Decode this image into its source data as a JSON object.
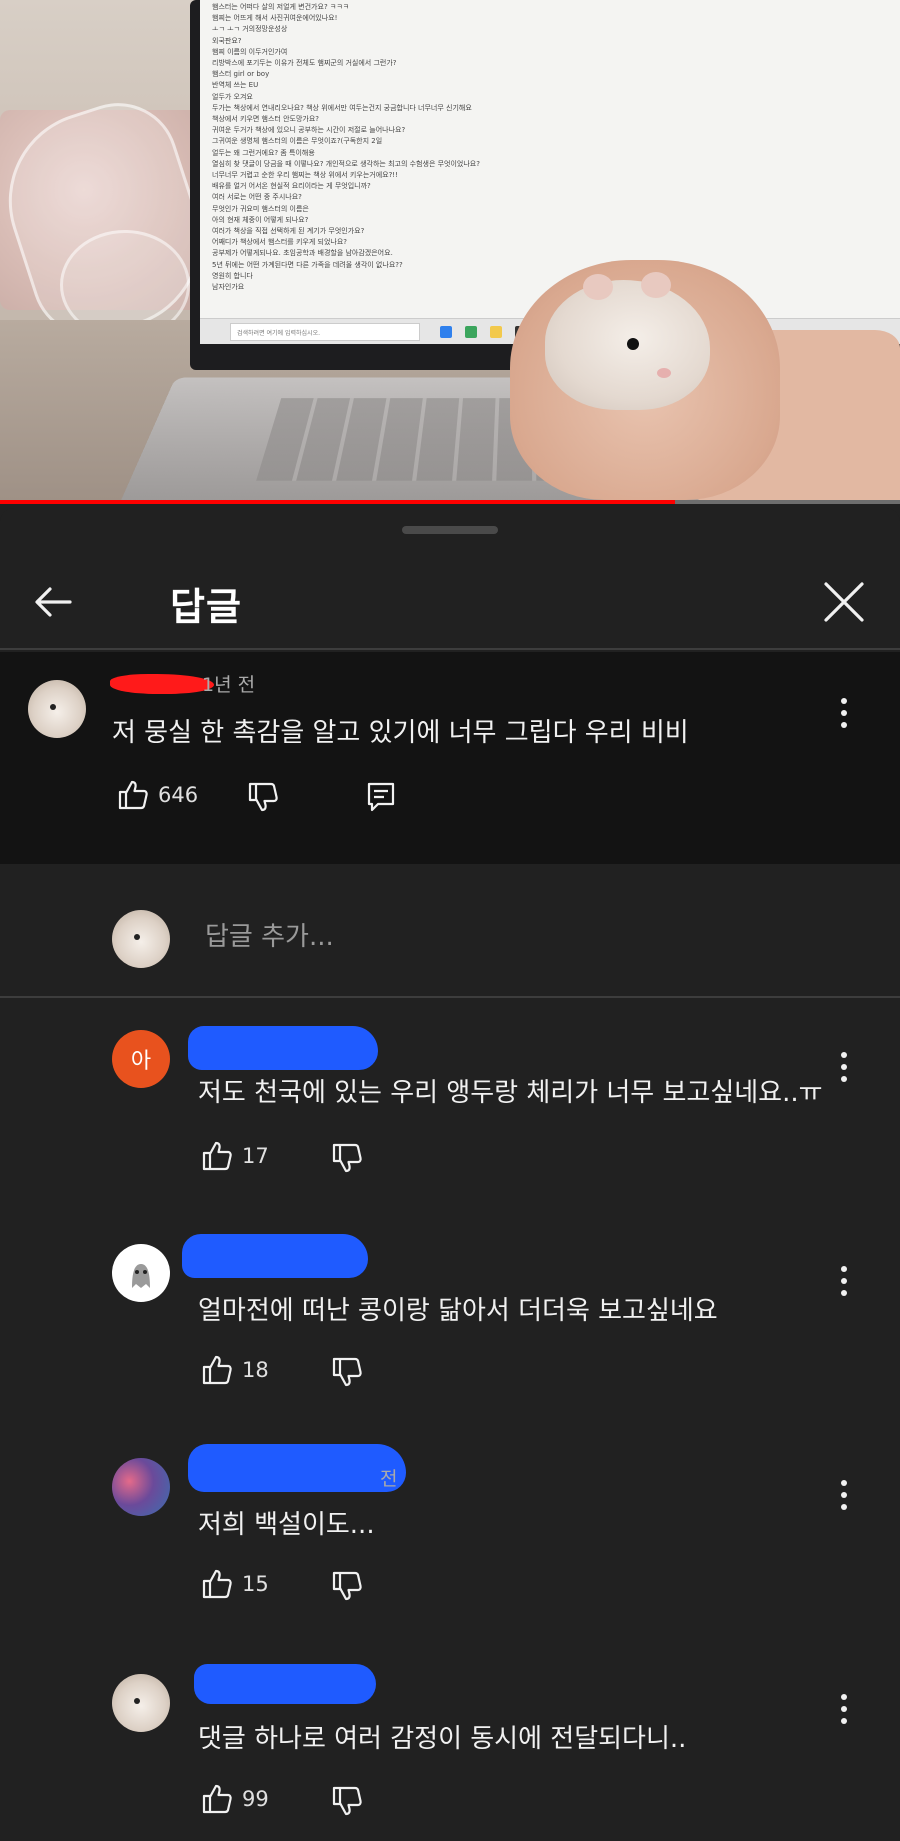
{
  "video": {
    "progress_fraction": 0.75,
    "doc_lines": [
      "햄스터는 어떠다 살의 저얼게 변건가요? ㅋㅋㅋ",
      "햄찌는 어뜨게 해서 사진귀여운에어있나요!",
      "ㅗㄱ ㅗㄱ 거의정망운성상",
      "외국판요?",
      "햄찌 이름의 이두거인가여",
      "리방박스에 포기두는 이유가 전체도 햄찌군의 거실에서 그런가?",
      "햄스터 girl or boy",
      "반역체 쓰는 EU",
      "얼두가 오겨요",
      "두가는 책상에서 연내리오나요? 책상 위에서만 여두는건지 궁금합니다 너무너무 신기해요",
      "책상에서 키우면 햄스터 안도망가요?",
      "귀여운 두거가 책상에 있으니 공부하는 시간이 저절로 늘어나나요?",
      "그귀여운 생명체 햄스터의 이름은 무엇이죠?(구독한지 2일",
      "얼두는 왜 그런거에요? 좀 특이해용",
      "열심히 찾 댓글이 당금을 때 이떻나요? 개인적으로 생각하는 최고의 수험생은 무엇이었나요?",
      "너무너무 거렵고 순한 우리 햄찌는 책상 위에서 키우는거에요?!!",
      "배유를 얼거 어서온 현실적 요리이라는 게 무엇입니까?",
      "여러 서로는 어떤 중 주시나요?",
      "무엇인가 귀요미 햄스터의 이름은",
      "아의 현재 체중이 어떻게 되나요?",
      "여러가 책상을 직접 선택하게 된 계기가 무엇인가요?",
      "어째디가 책상에서 햄스터를 키우게 되었나요?",
      "공부제가 어떻게되나요. 초임공학과 배경할을 남아감겠은어요.",
      "5년 뒤에는 어떤 가계된다면 다른 가족을 데려올 생각이 없나요??",
      "영원히 합니다",
      "남자인가요"
    ],
    "taskbar_search": "검색하려면 여기에 입력하십시오."
  },
  "panel": {
    "title": "답글",
    "back_icon": "arrow-left-icon",
    "close_icon": "close-x-icon"
  },
  "parent_comment": {
    "time": "1년 전",
    "text": "저 뭉실 한 촉감을 알고 있기에 너무 그립다 우리 비비",
    "likes": "646",
    "redact_color": "#ff1a1a"
  },
  "add_reply": {
    "placeholder": "답글 추가..."
  },
  "replies": [
    {
      "avatar_letter": "아",
      "text": "저도 천국에 있는 우리 앵두랑 체리가 너무 보고싶네요..ㅠ",
      "likes": "17",
      "time": ""
    },
    {
      "avatar_letter": "",
      "text": "얼마전에 떠난 콩이랑 닮아서 더더욱 보고싶네요",
      "likes": "18",
      "time": ""
    },
    {
      "avatar_letter": "",
      "text": "저희 백설이도...",
      "likes": "15",
      "time": "전"
    },
    {
      "avatar_letter": "",
      "text": "댓글 하나로 여러 감정이 동시에 전달되다니..",
      "likes": "99",
      "time": ""
    }
  ],
  "colors": {
    "panel_bg": "#212121",
    "parent_bg": "#131313",
    "redact_blue": "#1f5bff",
    "progress_red": "#ff0000"
  }
}
